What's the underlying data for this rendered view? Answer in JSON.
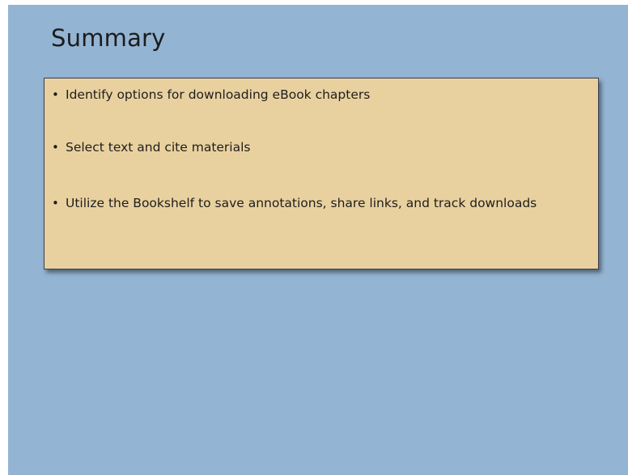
{
  "slide": {
    "title": "Summary",
    "bullets": [
      "Identify options for downloading eBook chapters",
      "Select text and cite materials",
      "Utilize the Bookshelf to save annotations, share links, and track downloads"
    ]
  },
  "colors": {
    "slide_background": "#93b4d3",
    "box_background": "#e9d19f",
    "box_border": "#3a4150"
  }
}
